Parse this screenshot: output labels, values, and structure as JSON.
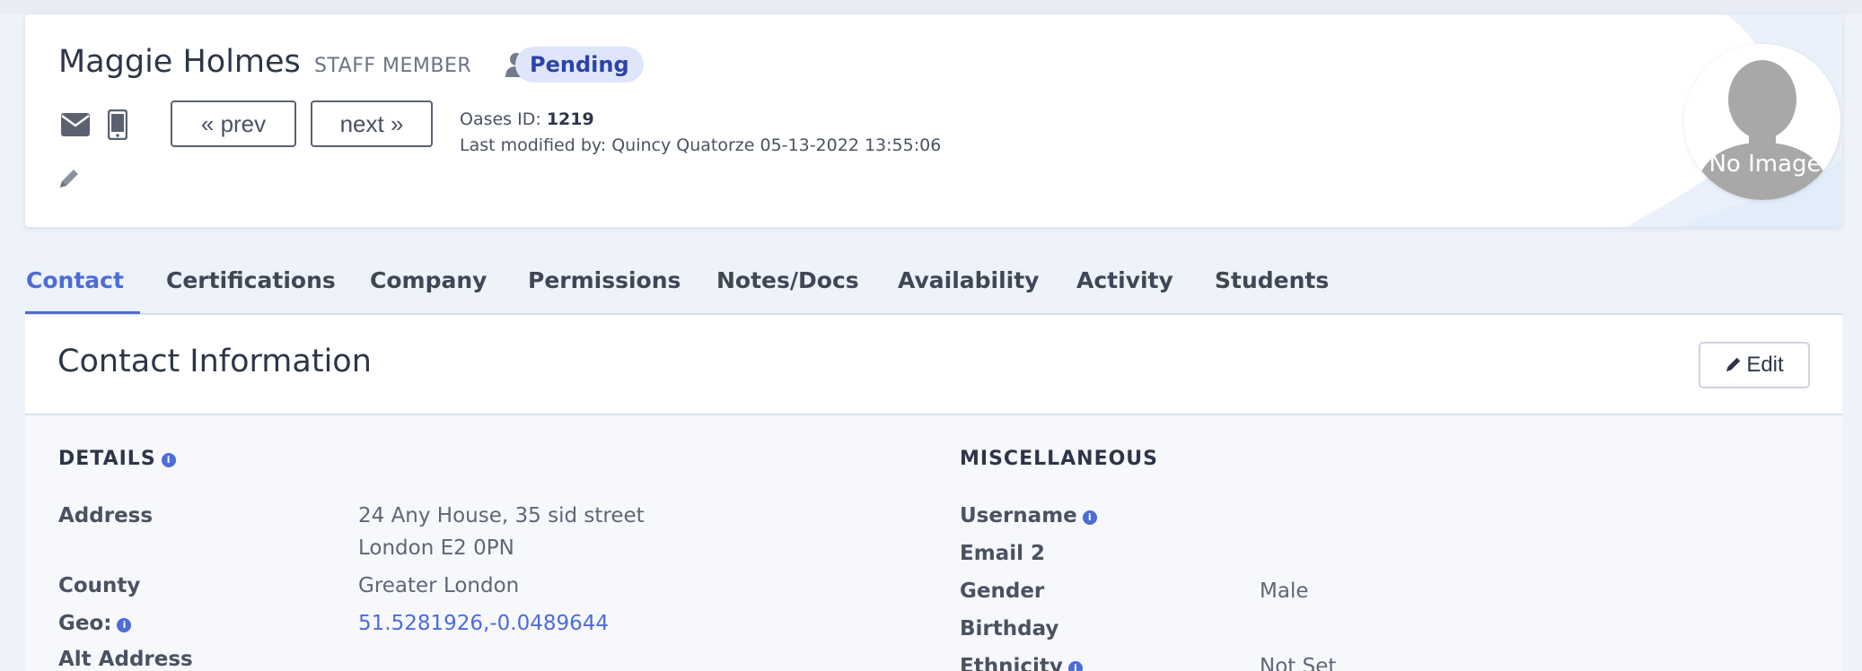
{
  "profile": {
    "name": "Maggie Holmes",
    "role": "STAFF MEMBER",
    "status": "Pending",
    "prev_label": "prev",
    "next_label": "next",
    "oases_label": "Oases ID:",
    "oases_id": "1219",
    "last_modified": "Last modified by: Quincy Quatorze 05-13-2022 13:55:06",
    "avatar_text": "No Image"
  },
  "tabs": [
    "Contact",
    "Certifications",
    "Company",
    "Permissions",
    "Notes/Docs",
    "Availability",
    "Activity",
    "Students"
  ],
  "contact": {
    "title": "Contact Information",
    "edit_label": "Edit",
    "details_title": "DETAILS",
    "misc_title": "MISCELLANEOUS",
    "details": {
      "address_label": "Address",
      "address_line1": "24 Any House, 35 sid street",
      "address_line2": "London E2 0PN",
      "county_label": "County",
      "county_value": "Greater London",
      "geo_label": "Geo:",
      "geo_value": "51.5281926,-0.0489644",
      "alt_address_label": "Alt Address"
    },
    "misc": {
      "username_label": "Username",
      "email2_label": "Email 2",
      "gender_label": "Gender",
      "gender_value": "Male",
      "birthday_label": "Birthday",
      "ethnicity_label": "Ethnicity",
      "ethnicity_value": "Not Set"
    }
  },
  "colors": {
    "accent": "#4d6bd9",
    "badge_bg": "#dfe6fb",
    "badge_text": "#2c43a7",
    "page_bg": "#eef2f9"
  },
  "icons": [
    "user-icon",
    "mail-icon",
    "phone-icon",
    "chevron-double-left-icon",
    "chevron-double-right-icon",
    "pencil-icon",
    "info-icon"
  ]
}
